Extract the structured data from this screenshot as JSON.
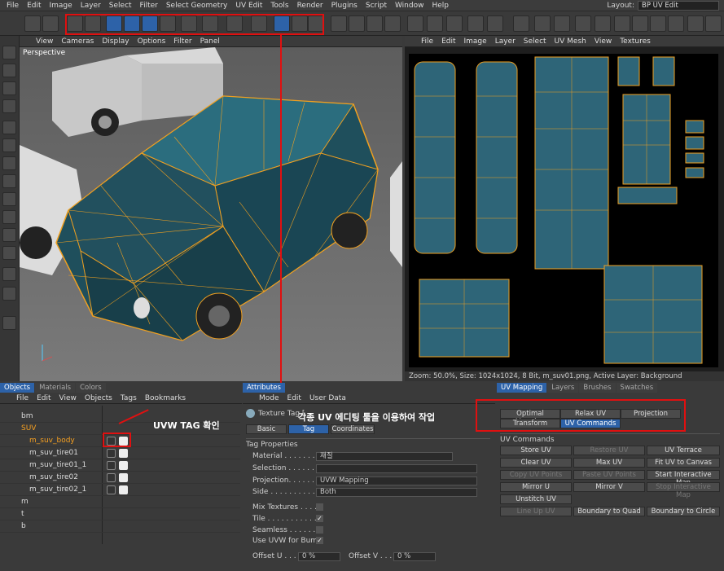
{
  "menu": [
    "File",
    "Edit",
    "Image",
    "Layer",
    "Select",
    "Filter",
    "Select Geometry",
    "UV Edit",
    "Tools",
    "Render",
    "Plugins",
    "Script",
    "Window",
    "Help"
  ],
  "layout": {
    "label": "Layout:",
    "value": "BP UV Edit"
  },
  "viewport": {
    "menu": [
      "View",
      "Cameras",
      "Display",
      "Options",
      "Filter",
      "Panel"
    ],
    "name": "Perspective"
  },
  "uv": {
    "menu": [
      "File",
      "Edit",
      "Image",
      "Layer",
      "Select",
      "UV Mesh",
      "View",
      "Textures"
    ],
    "status": "Zoom: 50.0%, Size: 1024x1024, 8 Bit, m_suv01.png, Active Layer: Background"
  },
  "objects": {
    "tabs": [
      "Objects",
      "Materials",
      "Colors"
    ],
    "menu": [
      "File",
      "Edit",
      "View",
      "Objects",
      "Tags",
      "Bookmarks"
    ],
    "items": [
      {
        "name": "bm"
      },
      {
        "name": "SUV"
      },
      {
        "name": "m_suv_body"
      },
      {
        "name": "m_suv_tire01"
      },
      {
        "name": "m_suv_tire01_1"
      },
      {
        "name": "m_suv_tire02"
      },
      {
        "name": "m_suv_tire02_1"
      },
      {
        "name": "m"
      },
      {
        "name": "t"
      },
      {
        "name": "b"
      }
    ]
  },
  "attributes": {
    "tab": "Attributes",
    "menu": [
      "Mode",
      "Edit",
      "User Data"
    ],
    "title": "Texture Tag [",
    "subtabs": [
      "Basic",
      "Tag",
      "Coordinates"
    ],
    "section": "Tag Properties",
    "material_label": "Material . . . . . . . .",
    "material_value": "재질",
    "selection_label": "Selection . . . . . . .",
    "projection_label": "Projection. . . . . . .",
    "projection_value": "UVW Mapping",
    "side_label": "Side . . . . . . . . . .",
    "side_value": "Both",
    "mix_label": "Mix Textures . . . . .",
    "tile_label": "Tile . . . . . . . . . . . .",
    "seamless_label": "Seamless . . . . . . .",
    "uvw_bump_label": "Use UVW for Bump",
    "offset_u_label": "Offset U . . . . .",
    "offset_u_value": "0 %",
    "offset_v_label": "Offset V . . . . .",
    "offset_v_value": "0 %"
  },
  "uvmap": {
    "tabs": [
      "UV Mapping",
      "Layers",
      "Brushes",
      "Swatches"
    ],
    "mode_buttons": [
      "Optimal Mapping",
      "Relax UV",
      "Projection",
      "Transform",
      "UV Commands"
    ],
    "section": "UV Commands",
    "commands": [
      "Store UV",
      "Restore UV",
      "UV Terrace",
      "Clear UV",
      "Max UV",
      "Fit UV to Canvas",
      "Copy UV Points",
      "Paste UV Points",
      "Start Interactive Map",
      "Mirror U",
      "Mirror V",
      "Stop Interactive Map",
      "Unstitch UV",
      "Line Up UV",
      "Boundary to Quad",
      "Boundary to Circle"
    ]
  },
  "annotations": {
    "uvw_tag": "UVW TAG 확인",
    "uv_tools": "각종 UV 에디팅 툴을 이용하여 작업"
  },
  "colors": {
    "accent": "#2d62a8",
    "annotation": "#e01010",
    "wire": "#f0a020",
    "body": "#1f4f5c"
  }
}
